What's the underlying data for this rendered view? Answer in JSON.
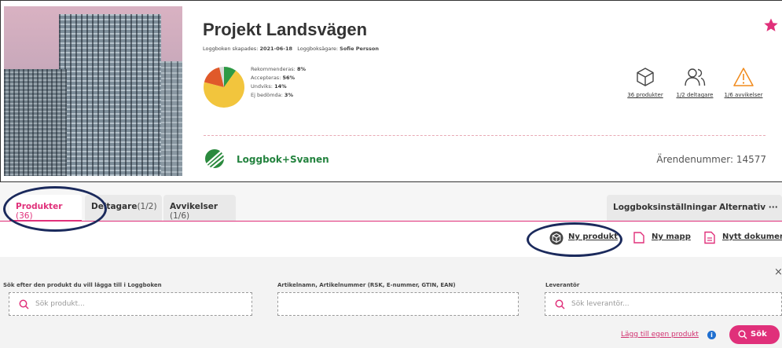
{
  "project": {
    "title": "Projekt Landsvägen",
    "created_label": "Loggboken skapades:",
    "created_date": "2021-06-18",
    "owner_label": "Loggboksägare:",
    "owner_name": "Sofie Persson"
  },
  "assessment": {
    "slices": [
      {
        "label": "Rekommenderas:",
        "value": "8%",
        "pct": 8,
        "color": "#2e9a45"
      },
      {
        "label": "Accepteras:",
        "value": "56%",
        "pct": 56,
        "color": "#f2c53d"
      },
      {
        "label": "Undviks:",
        "value": "14%",
        "pct": 14,
        "color": "#e0592a"
      },
      {
        "label": "Ej bedömda:",
        "value": "3%",
        "pct": 3,
        "color": "#d9d9d9"
      }
    ]
  },
  "stats": {
    "products": "36 produkter",
    "participants": "1/2 deltagare",
    "deviations": "1/6 avvikelser"
  },
  "certification": {
    "label": "Loggbok+Svanen",
    "case_number": "Ärendenummer: 14577"
  },
  "tabs": [
    {
      "label": "Produkter",
      "count": "(36)"
    },
    {
      "label": "Deltagare",
      "count": "(1/2)"
    },
    {
      "label": "Avvikelser",
      "count": "(1/6)"
    }
  ],
  "toolbar": {
    "settings": "Loggboksinställningar",
    "alternatives": "Alternativ ···"
  },
  "actions": {
    "new_product": "Ny produkt",
    "new_folder": "Ny mapp",
    "new_document": "Nytt dokument"
  },
  "search": {
    "product_label": "Sök efter den produkt du vill lägga till i Loggboken",
    "product_placeholder": "Sök produkt...",
    "article_label": "Artikelnamn, Artikelnummer (RSK, E-nummer, GTIN, EAN)",
    "article_placeholder": "",
    "supplier_label": "Leverantör",
    "supplier_placeholder": "Sök leverantör...",
    "close": "×",
    "add_own": "Lägg till egen produkt",
    "info": "i",
    "submit": "Sök"
  },
  "colors": {
    "accent": "#e0307a",
    "svanen_green": "#24833f",
    "warning": "#f08a1c",
    "annotation": "#1b2a5c"
  }
}
